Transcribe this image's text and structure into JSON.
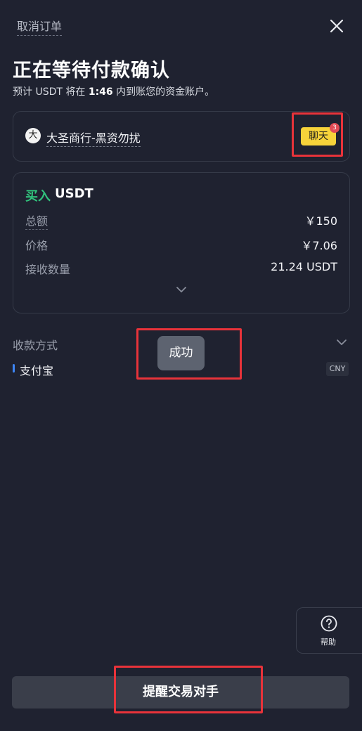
{
  "header": {
    "cancel_label": "取消订单",
    "close_icon": "close-icon"
  },
  "status": {
    "title": "正在等待付款确认",
    "subtitle_prefix": "预计 USDT 将在 ",
    "countdown": "1:46",
    "subtitle_suffix": " 内到账您的资金账户。"
  },
  "merchant": {
    "avatar_text": "大",
    "name": "大圣商行-黑资勿扰",
    "chat_label": "聊天",
    "unread_count": "3"
  },
  "order": {
    "side": "买入",
    "asset": "USDT",
    "rows": [
      {
        "label": "总额",
        "value": "￥150"
      },
      {
        "label": "价格",
        "value": "￥7.06"
      },
      {
        "label": "接收数量",
        "value": "21.24 USDT"
      }
    ]
  },
  "payment": {
    "label": "收款方式",
    "method": "支付宝",
    "currency": "CNY"
  },
  "toast": {
    "text": "成功"
  },
  "help": {
    "label": "帮助"
  },
  "footer": {
    "remind_label": "提醒交易对手"
  },
  "colors": {
    "background": "#1f2230",
    "buy_green": "#31c27c",
    "chat_yellow": "#f7d33a",
    "highlight_red": "#e8333a",
    "alipay_blue": "#3e86f5"
  }
}
